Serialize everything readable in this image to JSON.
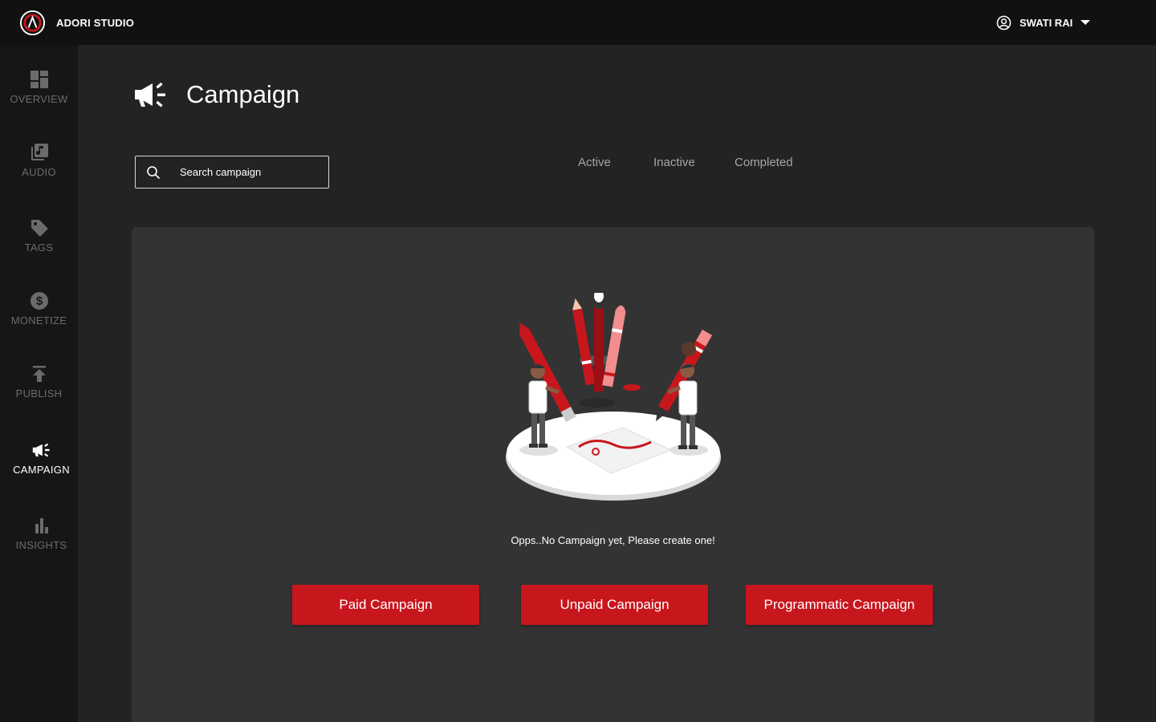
{
  "brand": {
    "name": "ADORI STUDIO",
    "icon": "adori-logo-icon"
  },
  "user": {
    "name": "SWATI RAI",
    "icon": "account-circle-icon",
    "menu_icon": "caret-down-icon"
  },
  "sidebar": {
    "items": [
      {
        "label": "OVERVIEW",
        "icon": "dashboard-icon",
        "active": false
      },
      {
        "label": "AUDIO",
        "icon": "music-library-icon",
        "active": false
      },
      {
        "label": "TAGS",
        "icon": "tag-icon",
        "active": false
      },
      {
        "label": "MONETIZE",
        "icon": "dollar-icon",
        "active": false
      },
      {
        "label": "PUBLISH",
        "icon": "publish-icon",
        "active": false
      },
      {
        "label": "CAMPAIGN",
        "icon": "megaphone-icon",
        "active": true
      },
      {
        "label": "INSIGHTS",
        "icon": "bar-chart-icon",
        "active": false
      }
    ]
  },
  "header": {
    "title": "Campaign",
    "icon": "megaphone-icon"
  },
  "search": {
    "placeholder": "Search campaign",
    "value": ""
  },
  "tabs": [
    {
      "label": "Active"
    },
    {
      "label": "Inactive"
    },
    {
      "label": "Completed"
    }
  ],
  "empty_state": {
    "message": "Opps..No Campaign yet, Please create one!",
    "illustration": "pencils-illustration"
  },
  "actions": {
    "paid": "Paid Campaign",
    "unpaid": "Unpaid Campaign",
    "programmatic": "Programmatic Campaign"
  },
  "colors": {
    "accent": "#c8161d",
    "topbar": "#111111",
    "sidebar": "#161616",
    "background": "#232323",
    "panel": "#333333"
  }
}
